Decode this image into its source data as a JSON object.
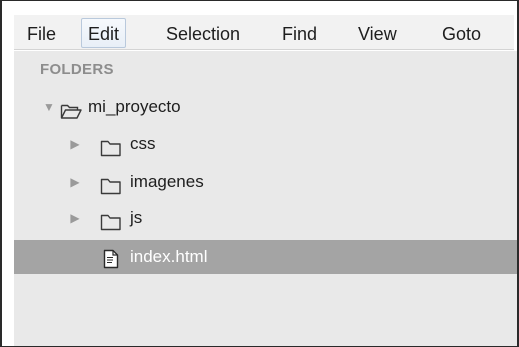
{
  "menu": {
    "items": [
      {
        "label": "File"
      },
      {
        "label": "Edit"
      },
      {
        "label": "Selection"
      },
      {
        "label": "Find"
      },
      {
        "label": "View"
      },
      {
        "label": "Goto"
      }
    ],
    "active_item": "Edit"
  },
  "sidebar": {
    "heading": "FOLDERS",
    "root": {
      "label": "mi_proyecto",
      "expanded": true,
      "icon": "folder-open-icon"
    },
    "children": [
      {
        "label": "css",
        "type": "folder",
        "expanded": false,
        "icon": "folder-icon"
      },
      {
        "label": "imagenes",
        "type": "folder",
        "expanded": false,
        "icon": "folder-icon"
      },
      {
        "label": "js",
        "type": "folder",
        "expanded": false,
        "icon": "folder-icon"
      },
      {
        "label": "index.html",
        "type": "file",
        "selected": true,
        "icon": "file-icon"
      }
    ]
  },
  "colors": {
    "selection_bg": "#a4a4a4",
    "sidebar_bg": "#e9e9e9",
    "heading": "#8d8d8d"
  }
}
